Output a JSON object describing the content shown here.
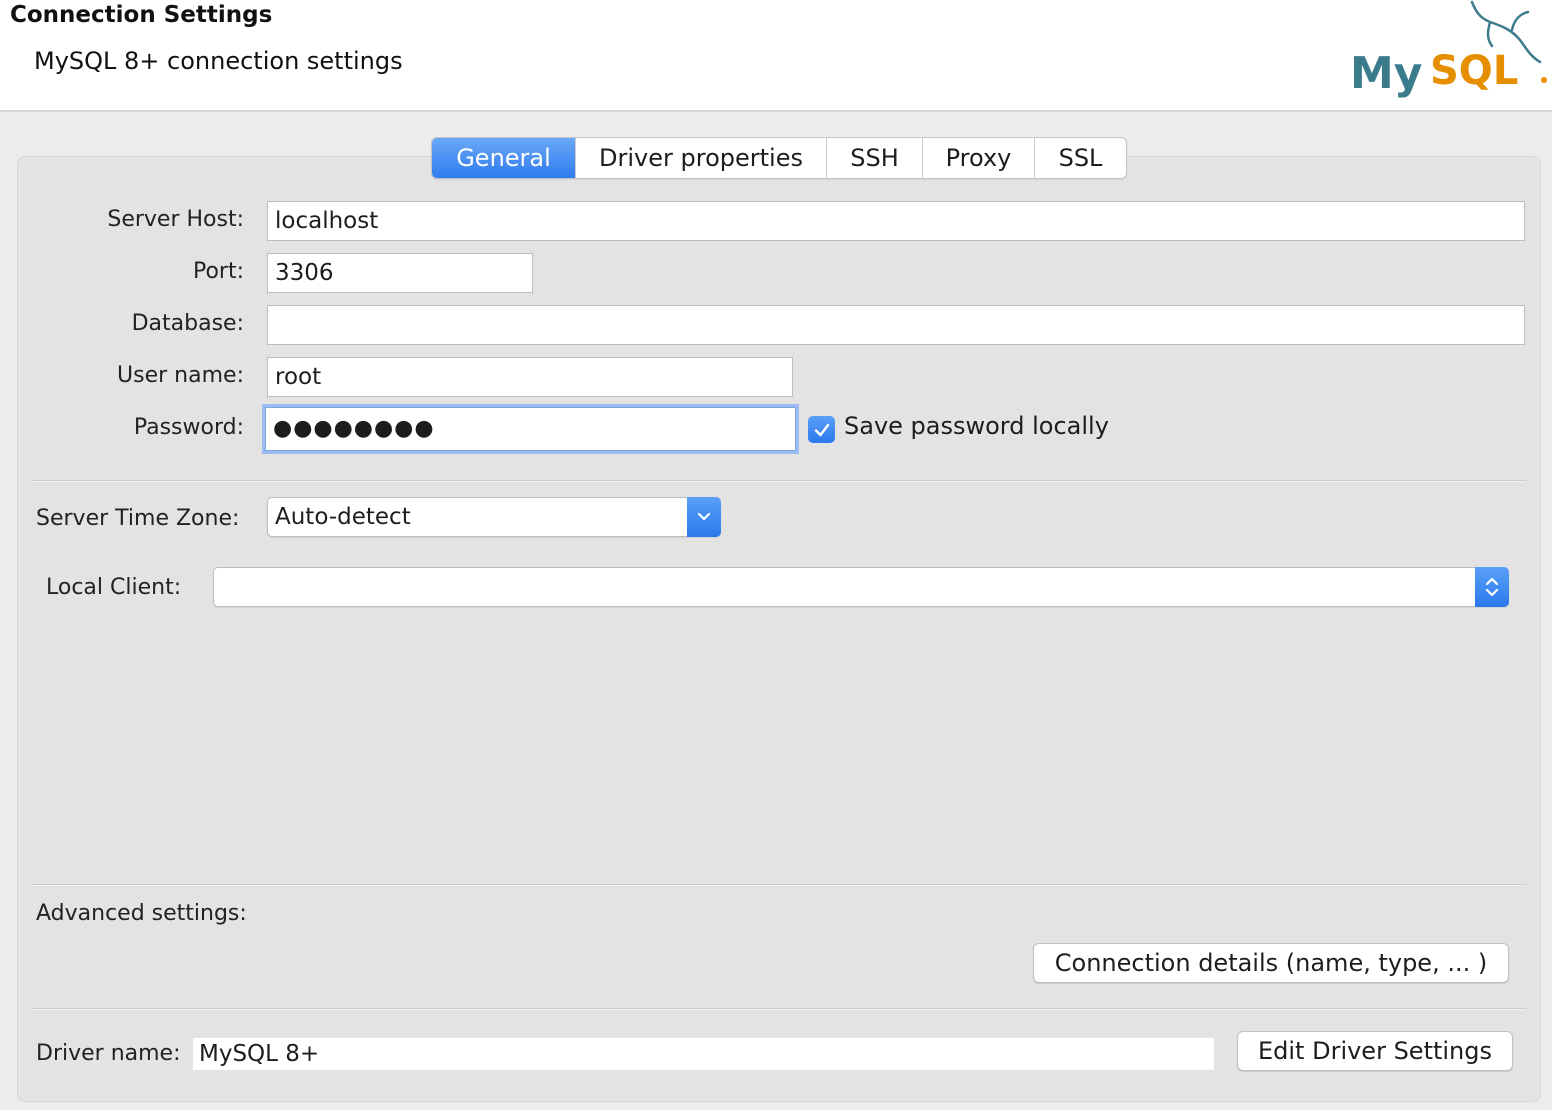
{
  "header": {
    "title": "Connection Settings",
    "subtitle": "MySQL 8+ connection settings",
    "logo_text": "MySQL",
    "logo_color": "#3b7c8c",
    "logo_accent": "#e48e00"
  },
  "tabs": [
    {
      "label": "General",
      "active": true
    },
    {
      "label": "Driver properties",
      "active": false
    },
    {
      "label": "SSH",
      "active": false
    },
    {
      "label": "Proxy",
      "active": false
    },
    {
      "label": "SSL",
      "active": false
    }
  ],
  "form": {
    "server_host": {
      "label": "Server Host:",
      "value": "localhost"
    },
    "port": {
      "label": "Port:",
      "value": "3306"
    },
    "database": {
      "label": "Database:",
      "value": ""
    },
    "user_name": {
      "label": "User name:",
      "value": "root"
    },
    "password": {
      "label": "Password:",
      "value": "●●●●●●●●"
    },
    "save_password": {
      "label": "Save password locally",
      "checked": true
    },
    "server_time_zone": {
      "label": "Server Time Zone:",
      "value": "Auto-detect"
    },
    "local_client": {
      "label": "Local Client:",
      "value": ""
    }
  },
  "advanced": {
    "label": "Advanced settings:",
    "connection_details_button": "Connection details (name, type, ... )"
  },
  "driver": {
    "label": "Driver name:",
    "value": "MySQL 8+",
    "edit_button": "Edit Driver Settings"
  },
  "colors": {
    "accent": "#2f7cf0",
    "focus_ring": "#9cbcf2"
  }
}
